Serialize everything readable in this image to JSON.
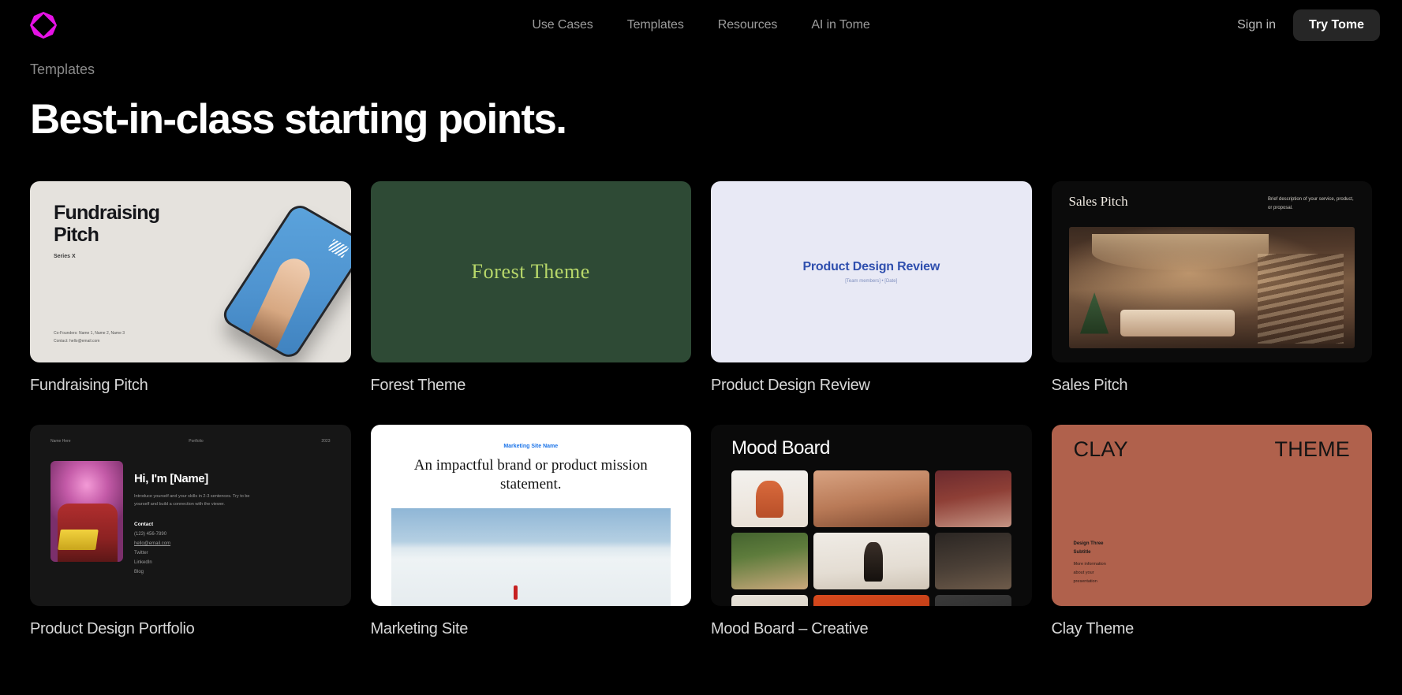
{
  "header": {
    "logo_name": "tome-logo",
    "logo_color": "#e612e6",
    "nav": [
      {
        "label": "Use Cases"
      },
      {
        "label": "Templates"
      },
      {
        "label": "Resources"
      },
      {
        "label": "AI in Tome"
      }
    ],
    "sign_in": "Sign in",
    "try_tome": "Try Tome"
  },
  "page": {
    "breadcrumb": "Templates",
    "title": "Best-in-class starting points."
  },
  "cards": [
    {
      "label": "Fundraising Pitch",
      "thumb": {
        "bg": "#e5e2dd",
        "title": "Fundraising\nPitch",
        "subtitle": "Series X",
        "footer": "Co-Founders: Name 1, Name 2, Name 3\nContact: hello@email.com"
      }
    },
    {
      "label": "Forest Theme",
      "thumb": {
        "bg": "#2e4a35",
        "title": "Forest Theme",
        "accent": "#b8d86a"
      }
    },
    {
      "label": "Product Design Review",
      "thumb": {
        "bg": "#e8e9f5",
        "title": "Product Design Review",
        "subtitle": "[Team members] • [Date]",
        "accent": "#2f4fae"
      }
    },
    {
      "label": "Sales Pitch",
      "thumb": {
        "bg": "#0b0b0b",
        "title": "Sales Pitch",
        "description": "Brief description of your service, product, or proposal."
      }
    },
    {
      "label": "Product Design Portfolio",
      "thumb": {
        "bg": "#161616",
        "bar_left": "Name Here",
        "bar_mid": "Portfolio",
        "bar_right": "2023",
        "heading": "Hi, I'm [Name]",
        "paragraph": "Introduce yourself and your skills in 2-3 sentences. Try to be yourself and build a connection with the viewer.",
        "contact_heading": "Contact",
        "contact_items": [
          "(123) 456-7890",
          "hello@email.com",
          "Twitter",
          "LinkedIn",
          "Blog"
        ]
      }
    },
    {
      "label": "Marketing Site",
      "thumb": {
        "bg": "#ffffff",
        "site_name": "Marketing Site Name",
        "headline": "An impactful brand or product mission statement.",
        "accent": "#1a73e8"
      }
    },
    {
      "label": "Mood Board – Creative",
      "thumb": {
        "bg": "#0a0a0a",
        "title": "Mood Board"
      }
    },
    {
      "label": "Clay Theme",
      "thumb": {
        "bg": "#b0614c",
        "title_left": "CLAY",
        "title_right": "THEME",
        "body_1": "Design Three\nSubtitle",
        "body_2": "More information\nabout your\npresentation"
      }
    }
  ]
}
